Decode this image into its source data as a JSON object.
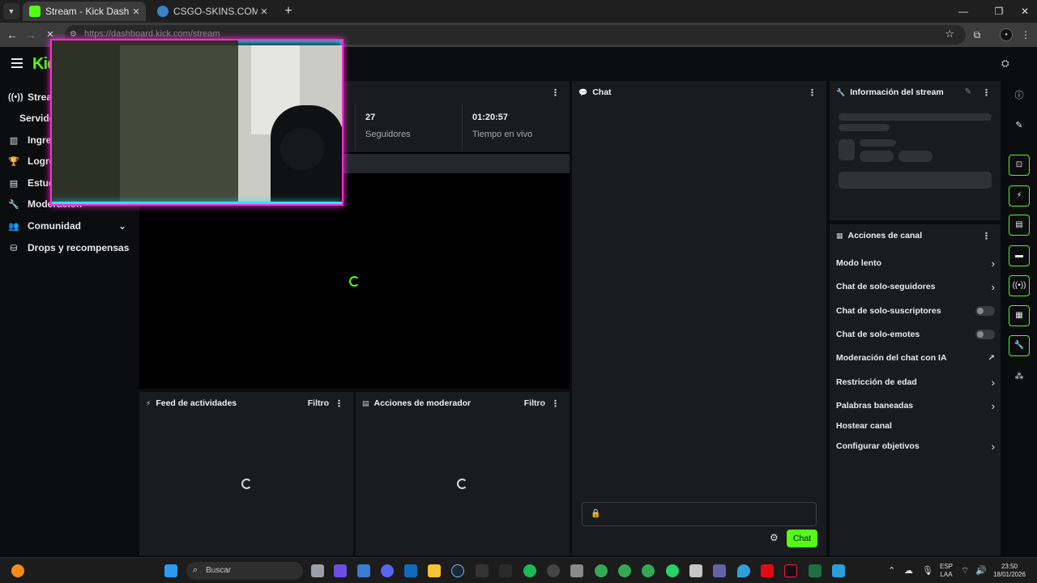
{
  "browser": {
    "tabs": [
      {
        "title": "Stream - Kick Dashboard",
        "active": true
      },
      {
        "title": "CSGO-SKINS.COM - Los mejore",
        "active": false
      }
    ],
    "url": "https://dashboard.kick.com/stream"
  },
  "app": {
    "logo": "Kick"
  },
  "sidebar": {
    "items": [
      {
        "label": "Stream",
        "icon": "broadcast-icon"
      },
      {
        "label": "Servidor"
      },
      {
        "label": "Ingresos",
        "icon": "chart-icon"
      },
      {
        "label": "Logros",
        "icon": "trophy-icon"
      },
      {
        "label": "Estudio",
        "icon": "studio-icon"
      },
      {
        "label": "Moderación",
        "icon": "wrench-icon"
      },
      {
        "label": "Comunidad",
        "icon": "people-icon"
      },
      {
        "label": "Drops y recompensas",
        "icon": "gift-icon"
      }
    ]
  },
  "stats": [
    {
      "value": "27",
      "label": "Seguidores"
    },
    {
      "value": "01:20:57",
      "label": "Tiempo en vivo"
    }
  ],
  "panels": {
    "chat_title": "Chat",
    "stream_info_title": "Información del stream",
    "channel_actions_title": "Acciones de canal",
    "activity_feed_title": "Feed de actividades",
    "mod_actions_title": "Acciones de moderador",
    "filter_label": "Filtro"
  },
  "channel_actions": [
    {
      "label": "Modo lento",
      "control": "chevron"
    },
    {
      "label": "Chat de solo-seguidores",
      "control": "chevron"
    },
    {
      "label": "Chat de solo-suscriptores",
      "control": "toggle",
      "enabled": false
    },
    {
      "label": "Chat de solo-emotes",
      "control": "toggle",
      "enabled": false
    },
    {
      "label": "Moderación del chat con IA",
      "control": "external"
    },
    {
      "label": "Restricción de edad",
      "control": "chevron"
    },
    {
      "label": "Palabras baneadas",
      "control": "chevron"
    },
    {
      "label": "Hostear canal",
      "control": "none"
    },
    {
      "label": "Configurar objetivos",
      "control": "chevron"
    }
  ],
  "chat": {
    "send_label": "Chat"
  },
  "taskbar": {
    "search_placeholder": "Buscar",
    "lang_top": "ESP",
    "lang_bottom": "LAA",
    "time": "23:50",
    "date": "18/01/2026"
  },
  "colors": {
    "accent": "#53fc18",
    "panel": "#191b1f",
    "background": "#0b0c0d"
  }
}
